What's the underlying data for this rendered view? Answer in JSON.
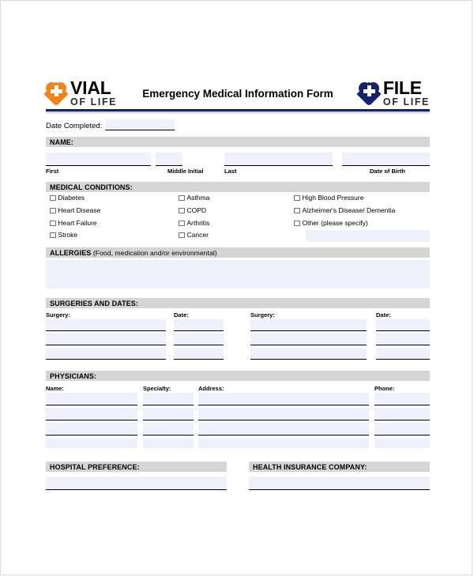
{
  "header": {
    "title": "Emergency Medical Information Form",
    "logo_left": {
      "main": "VIAL",
      "sub": "OF LIFE",
      "color": "#f1831d",
      "icon": "heart-cross-icon"
    },
    "logo_right": {
      "main": "FILE",
      "sub": "OF LIFE",
      "color": "#15246a",
      "icon": "heart-cross-icon"
    },
    "rule_color": "#15246a"
  },
  "date_completed": {
    "label": "Date Completed:",
    "value": "",
    "placeholder": ""
  },
  "sections": {
    "name": {
      "title": "NAME:",
      "fields": [
        {
          "caption": "First",
          "value": "",
          "placeholder": ""
        },
        {
          "caption": "Middle Initial",
          "value": "",
          "placeholder": ""
        },
        {
          "caption": "Last",
          "value": "",
          "placeholder": ""
        },
        {
          "caption": "Date of Birth",
          "value": "",
          "placeholder": ""
        }
      ]
    },
    "medical_conditions": {
      "title": "MEDICAL CONDITIONS:",
      "column1": [
        "Diabetes",
        "Heart Disease",
        "Heart Failure",
        "Stroke"
      ],
      "column2": [
        "Asthma",
        "COPD",
        "Arthritis",
        "Cancer"
      ],
      "column3": [
        "High Blood Pressure",
        "Alzheimer's Disease/ Dementia",
        "Other (please specify)"
      ],
      "other_value": "",
      "other_placeholder": ""
    },
    "allergies": {
      "title_bold": "ALLERGIES",
      "title_thin": " (Food, medication and/or environmental)",
      "value": "",
      "placeholder": ""
    },
    "surgeries": {
      "title": "SURGERIES AND DATES:",
      "headers": [
        "Surgery:",
        "Date:",
        "Surgery:",
        "Date:"
      ],
      "rows": [
        {
          "surgery_1": "",
          "date_1": "",
          "surgery_2": "",
          "date_2": ""
        },
        {
          "surgery_1": "",
          "date_1": "",
          "surgery_2": "",
          "date_2": ""
        },
        {
          "surgery_1": "",
          "date_1": "",
          "surgery_2": "",
          "date_2": ""
        }
      ]
    },
    "physicians": {
      "title": "PHYSICIANS:",
      "headers": [
        "Name:",
        "Specialty:",
        "Address:",
        "Phone:"
      ],
      "rows": [
        {
          "name": "",
          "specialty": "",
          "address": "",
          "phone": ""
        },
        {
          "name": "",
          "specialty": "",
          "address": "",
          "phone": ""
        },
        {
          "name": "",
          "specialty": "",
          "address": "",
          "phone": ""
        },
        {
          "name": "",
          "specialty": "",
          "address": "",
          "phone": ""
        }
      ]
    },
    "hospital_preference": {
      "title": "HOSPITAL PREFERENCE:",
      "value": "",
      "placeholder": ""
    },
    "health_insurance": {
      "title": "HEALTH INSURANCE COMPANY:",
      "value": "",
      "placeholder": ""
    }
  }
}
